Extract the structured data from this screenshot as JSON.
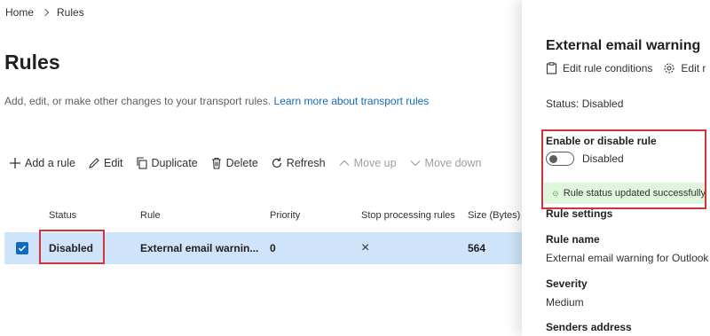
{
  "breadcrumb": {
    "home": "Home",
    "current": "Rules"
  },
  "page": {
    "title": "Rules",
    "subtitle": "Add, edit, or make other changes to your transport rules.",
    "learn_more": "Learn more about transport rules"
  },
  "toolbar": {
    "add": "Add a rule",
    "edit": "Edit",
    "duplicate": "Duplicate",
    "delete": "Delete",
    "refresh": "Refresh",
    "move_up": "Move up",
    "move_down": "Move down"
  },
  "table": {
    "columns": [
      "Status",
      "Rule",
      "Priority",
      "Stop processing rules",
      "Size (Bytes)"
    ],
    "rows": [
      {
        "status": "Disabled",
        "rule": "External email warnin...",
        "priority": "0",
        "stop": "×",
        "size": "564"
      }
    ]
  },
  "panel": {
    "title": "External email warning",
    "edit_conditions": "Edit rule conditions",
    "edit_settings": "Edit r",
    "status": "Status: Disabled",
    "enable_label": "Enable or disable rule",
    "toggle_text": "Disabled",
    "toggle_on": false,
    "success": "Rule status updated successfully",
    "rule_settings": "Rule settings",
    "rule_name_label": "Rule name",
    "rule_name_value": "External email warning for Outlook",
    "severity_label": "Severity",
    "severity_value": "Medium",
    "senders_label": "Senders address"
  },
  "colors": {
    "accent": "#0f6cbd",
    "highlight": "#d13438",
    "selected_row": "#cfe4fa",
    "success_bg": "#dff6dd",
    "success_icon": "#107c10"
  }
}
